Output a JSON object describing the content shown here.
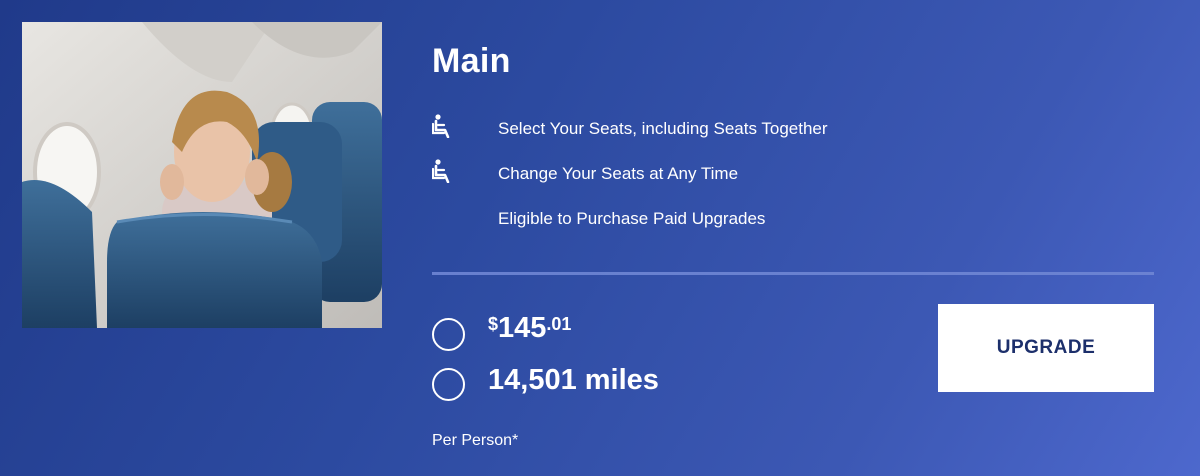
{
  "fare": {
    "title": "Main",
    "features": [
      {
        "icon": "seat-icon",
        "label": "Select Your Seats, including Seats Together"
      },
      {
        "icon": "seat-icon",
        "label": "Change Your Seats at Any Time"
      },
      {
        "icon": "",
        "label": "Eligible to Purchase Paid Upgrades"
      }
    ],
    "price": {
      "currency": "$",
      "whole": "145",
      "cents": ".01"
    },
    "miles": "14,501 miles",
    "per_person": "Per Person*",
    "upgrade_label": "UPGRADE"
  },
  "colors": {
    "background_start": "#203a8a",
    "background_end": "#4d68cd",
    "button_text": "#1c2f6b",
    "divider": "#6f86d4"
  }
}
